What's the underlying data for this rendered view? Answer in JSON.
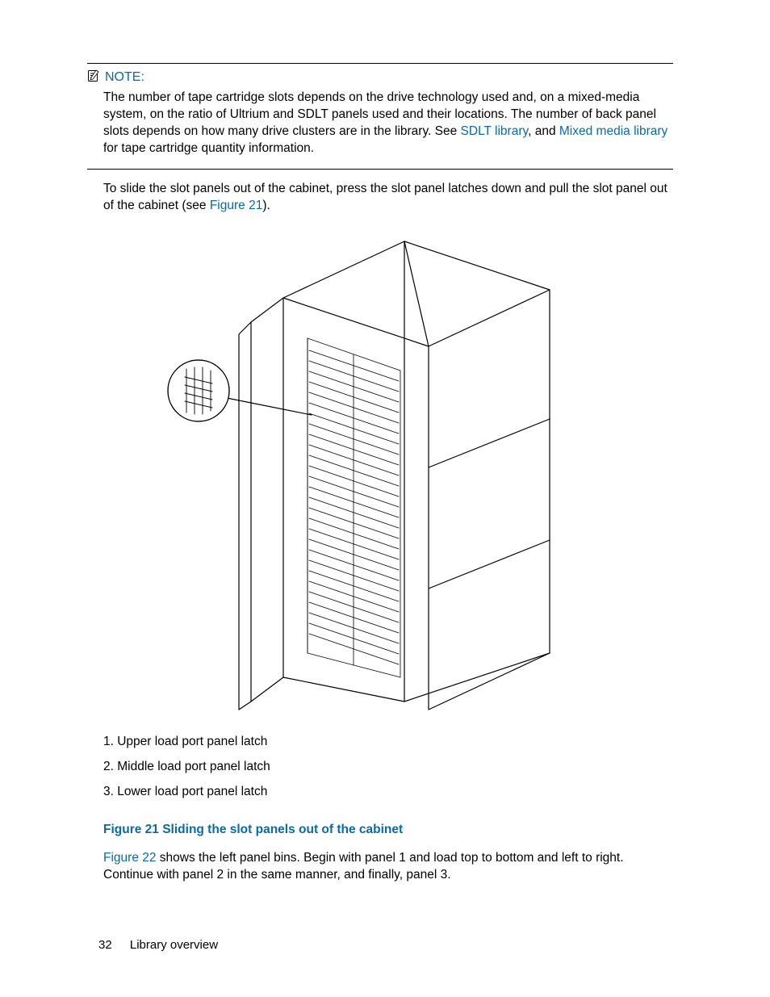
{
  "note": {
    "label": "NOTE:",
    "body_pre": "The number of tape cartridge slots depends on the drive technology used and, on a mixed-media system, on the ratio of Ultrium and SDLT panels used and their locations. The number of back panel slots depends on how many drive clusters are in the library. See ",
    "link1": "SDLT library",
    "body_mid": ", and ",
    "link2": "Mixed media library",
    "body_post": " for tape cartridge quantity information."
  },
  "para1": {
    "pre": "To slide the slot panels out of the cabinet, press the slot panel latches down and pull the slot panel out of the cabinet (see ",
    "link": "Figure 21",
    "post": ")."
  },
  "callouts": [
    "1. Upper load port panel latch",
    "2. Middle load port panel latch",
    "3. Lower load port panel latch"
  ],
  "figure_caption": "Figure 21 Sliding the slot panels out of the cabinet",
  "para2": {
    "link": "Figure 22",
    "post": " shows the left panel bins. Begin with panel 1 and load top to bottom and left to right. Continue with panel 2 in the same manner, and finally, panel 3."
  },
  "footer": {
    "page_number": "32",
    "section": "Library overview"
  }
}
